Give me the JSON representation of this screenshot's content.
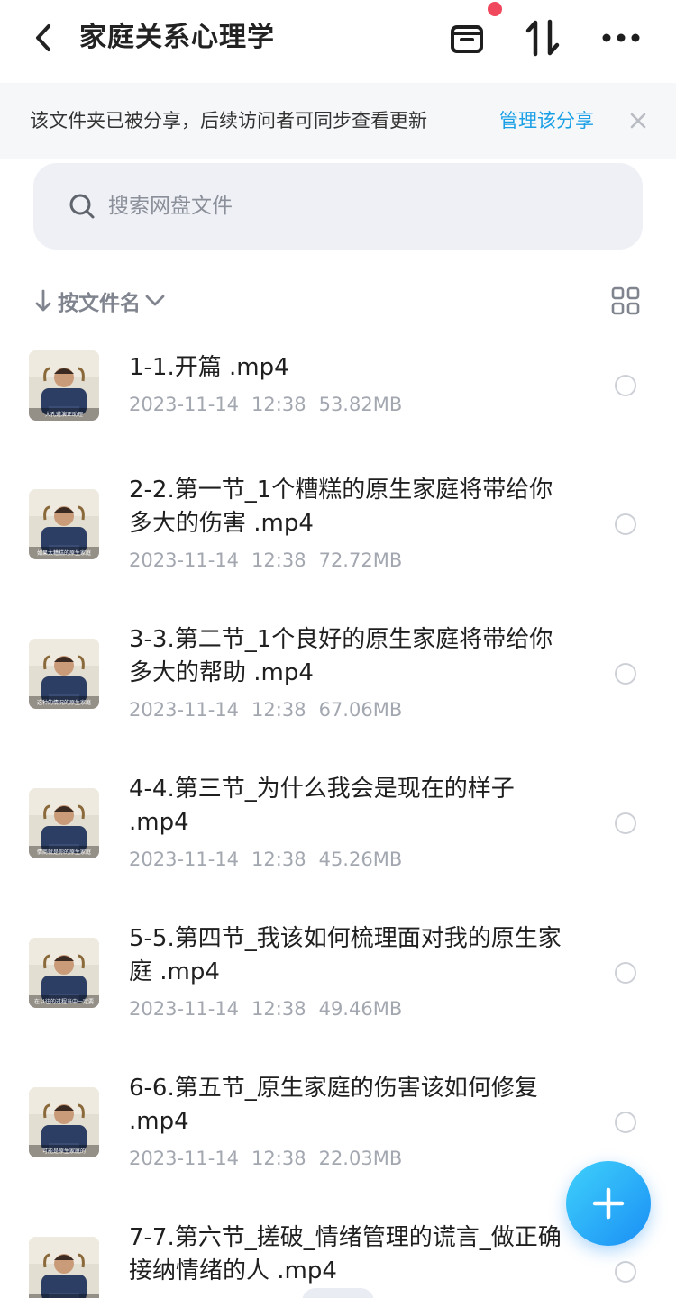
{
  "header": {
    "title": "家庭关系心理学",
    "back_icon": "chevron-left-icon",
    "archive_icon": "archive-box-icon",
    "sort_icon": "sort-arrows-icon",
    "more_icon": "more-dots-icon",
    "notification_dot_color": "#f0485c"
  },
  "notice": {
    "text": "该文件夹已被分享，后续访问者可同步查看更新",
    "link": "管理该分享",
    "close_icon": "close-icon",
    "link_color": "#1aa0e6"
  },
  "search": {
    "placeholder": "搜索网盘文件",
    "icon": "search-icon"
  },
  "sort": {
    "label": "按文件名",
    "arrow_icon": "arrow-down-icon",
    "chevron_icon": "chevron-down-icon",
    "view_icon": "grid-view-icon"
  },
  "files": [
    {
      "name": "1-1.开篇 .mp4",
      "date": "2023-11-14",
      "time": "12:38",
      "size": "53.82MB",
      "thumb_caption": "大孔道演正助理"
    },
    {
      "name": "2-2.第一节_1个糟糕的原生家庭将带给你多大的伤害 .mp4",
      "date": "2023-11-14",
      "time": "12:38",
      "size": "72.72MB",
      "thumb_caption": "如果太糟糕的原生家庭"
    },
    {
      "name": "3-3.第二节_1个良好的原生家庭将带给你多大的帮助 .mp4",
      "date": "2023-11-14",
      "time": "12:38",
      "size": "67.06MB",
      "thumb_caption": "这种的情况的原生家庭"
    },
    {
      "name": "4-4.第三节_为什么我会是现在的样子 .mp4",
      "date": "2023-11-14",
      "time": "12:38",
      "size": "45.26MB",
      "thumb_caption": "情商就是你的原生家庭"
    },
    {
      "name": "5-5.第四节_我该如何梳理面对我的原生家庭 .mp4",
      "date": "2023-11-14",
      "time": "12:38",
      "size": "49.46MB",
      "thumb_caption": "在以往的过程当中一定要"
    },
    {
      "name": "6-6.第五节_原生家庭的伤害该如何修复 .mp4",
      "date": "2023-11-14",
      "time": "12:38",
      "size": "22.03MB",
      "thumb_caption": "可能是原生家庭的"
    },
    {
      "name": "7-7.第六节_搓破_情绪管理的谎言_做正确接纳情绪的人 .mp4",
      "date": "",
      "time": "",
      "size": "",
      "thumb_caption": ""
    }
  ],
  "fab": {
    "icon": "plus-icon",
    "gradient_start": "#3fd1fb",
    "gradient_end": "#1a8ff5"
  }
}
